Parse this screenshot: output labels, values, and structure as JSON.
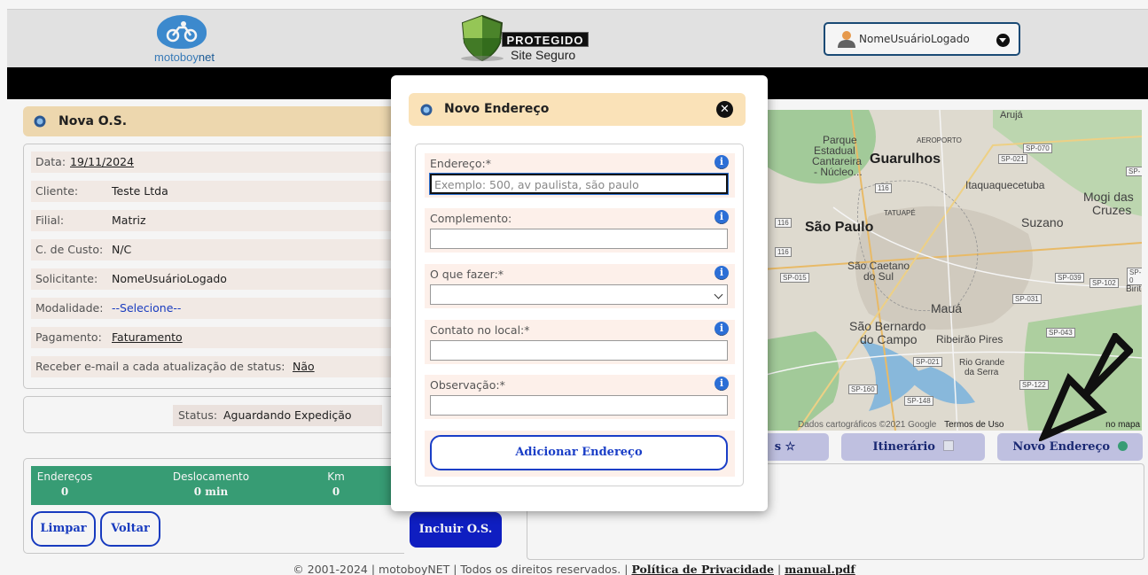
{
  "header": {
    "logo_prefix": "motoboy",
    "logo_suffix": "net",
    "security_badge": "PROTEGIDO",
    "security_sub": "Site Seguro",
    "user_name": "NomeUsuárioLogado"
  },
  "os": {
    "title": "Nova O.S.",
    "fields": {
      "data_label": "Data:",
      "data_value": "19/11/2024",
      "cliente_label": "Cliente:",
      "cliente_value": "Teste Ltda",
      "filial_label": "Filial:",
      "filial_value": "Matriz",
      "custo_label": "C. de Custo:",
      "custo_value": "N/C",
      "solicitante_label": "Solicitante:",
      "solicitante_value": "NomeUsuárioLogado",
      "modalidade_label": "Modalidade:",
      "modalidade_value": "--Selecione--",
      "pagamento_label": "Pagamento:",
      "pagamento_value": "Faturamento",
      "email_label": "Receber e-mail a cada atualização de status:",
      "email_value": "Não"
    },
    "status_label": "Status:",
    "status_value": "Aguardando Expedição",
    "summary": [
      {
        "label": "Endereços",
        "value": "0"
      },
      {
        "label": "Deslocamento",
        "value": "0 min"
      },
      {
        "label": "Km",
        "value": "0"
      }
    ],
    "btn_limpar": "Limpar",
    "btn_voltar": "Voltar",
    "btn_incluir": "Incluir O.S."
  },
  "map": {
    "labels": {
      "aruja": "Arujá",
      "parque": "Parque",
      "estadual": "Estadual",
      "cantareira": "Cantareira",
      "nucleo": "- Núcleo...",
      "aeroporto": "AEROPORTO",
      "guarulhos": "Guarulhos",
      "itaqua": "Itaquaquecetuba",
      "mogi1": "Mogi das",
      "mogi2": "Cruzes",
      "tatuape": "TATUAPÉ",
      "saopaulo": "São Paulo",
      "suzano": "Suzano",
      "saocaetano1": "São Caetano",
      "saocaetano2": "do Sul",
      "maua": "Mauá",
      "saobernardo1": "São Bernardo",
      "saobernardo2": "do Campo",
      "ribeirao": "Ribeirão Pires",
      "riogrande1": "Rio Grande",
      "riogrande2": "da Serra",
      "biriti": "Birit",
      "sp070": "SP-070",
      "sp021a": "SP-021",
      "sp021b": "SP-021",
      "r116a": "116",
      "r116b": "116",
      "r116c": "116",
      "sp015": "SP-015",
      "sp039": "SP-039",
      "sp102": "SP-102",
      "sp031": "SP-031",
      "sp043": "SP-043",
      "sp160": "SP-160",
      "sp148": "SP-148",
      "sp122": "SP-122",
      "sp0": "SP-0",
      "sp": "SP-"
    },
    "footer_data": "Dados cartográficos ©2021 Google",
    "footer_terms": "Termos de Uso",
    "footer_report": "no mapa",
    "tab_favoritos": "s ☆",
    "tab_itinerario": "Itinerário",
    "tab_novo": "Novo Endereço"
  },
  "modal": {
    "title": "Novo Endereço",
    "fields": {
      "endereco_label": "Endereço:*",
      "endereco_placeholder": "Exemplo: 500, av paulista, são paulo",
      "complemento_label": "Complemento:",
      "oque_label": "O que fazer:*",
      "contato_label": "Contato no local:*",
      "obs_label": "Observação:*"
    },
    "info_glyph": "i",
    "add_button": "Adicionar Endereço"
  },
  "footer": {
    "copyright": "© 2001-2024 | motoboyNET | Todos os direitos reservados. |",
    "privacy": "Política de Privacidade",
    "separator": "|",
    "manual": "manual.pdf"
  },
  "colors": {
    "accent_blue": "#1a3ec7",
    "header_peach": "#f7e0b6",
    "summary_green": "#3aa379",
    "map_tab": "#c7c8ea"
  }
}
